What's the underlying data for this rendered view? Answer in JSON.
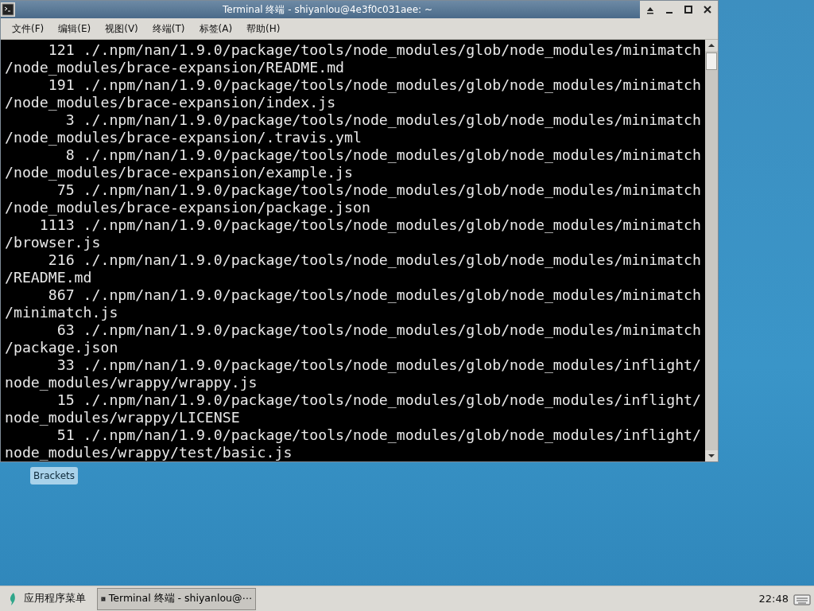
{
  "window": {
    "title": "Terminal 终端 - shiyanlou@4e3f0c031aee: ~"
  },
  "menu": [
    "文件(F)",
    "编辑(E)",
    "视图(V)",
    "终端(T)",
    "标签(A)",
    "帮助(H)"
  ],
  "terminal_lines": [
    "     121 ./.npm/nan/1.9.0/package/tools/node_modules/glob/node_modules/minimatch",
    "/node_modules/brace-expansion/README.md",
    "     191 ./.npm/nan/1.9.0/package/tools/node_modules/glob/node_modules/minimatch",
    "/node_modules/brace-expansion/index.js",
    "       3 ./.npm/nan/1.9.0/package/tools/node_modules/glob/node_modules/minimatch",
    "/node_modules/brace-expansion/.travis.yml",
    "       8 ./.npm/nan/1.9.0/package/tools/node_modules/glob/node_modules/minimatch",
    "/node_modules/brace-expansion/example.js",
    "      75 ./.npm/nan/1.9.0/package/tools/node_modules/glob/node_modules/minimatch",
    "/node_modules/brace-expansion/package.json",
    "    1113 ./.npm/nan/1.9.0/package/tools/node_modules/glob/node_modules/minimatch",
    "/browser.js",
    "     216 ./.npm/nan/1.9.0/package/tools/node_modules/glob/node_modules/minimatch",
    "/README.md",
    "     867 ./.npm/nan/1.9.0/package/tools/node_modules/glob/node_modules/minimatch",
    "/minimatch.js",
    "      63 ./.npm/nan/1.9.0/package/tools/node_modules/glob/node_modules/minimatch",
    "/package.json",
    "      33 ./.npm/nan/1.9.0/package/tools/node_modules/glob/node_modules/inflight/",
    "node_modules/wrappy/wrappy.js",
    "      15 ./.npm/nan/1.9.0/package/tools/node_modules/glob/node_modules/inflight/",
    "node_modules/wrappy/LICENSE",
    "      51 ./.npm/nan/1.9.0/package/tools/node_modules/glob/node_modules/inflight/",
    "node_modules/wrappy/test/basic.js"
  ],
  "desktop_icons": [
    {
      "label": "Brackets"
    }
  ],
  "taskbar": {
    "app_menu": "应用程序菜单",
    "tasks": [
      {
        "label": "Terminal 终端 - shiyanlou@⋯",
        "selected": true
      }
    ],
    "clock": "22:48"
  }
}
